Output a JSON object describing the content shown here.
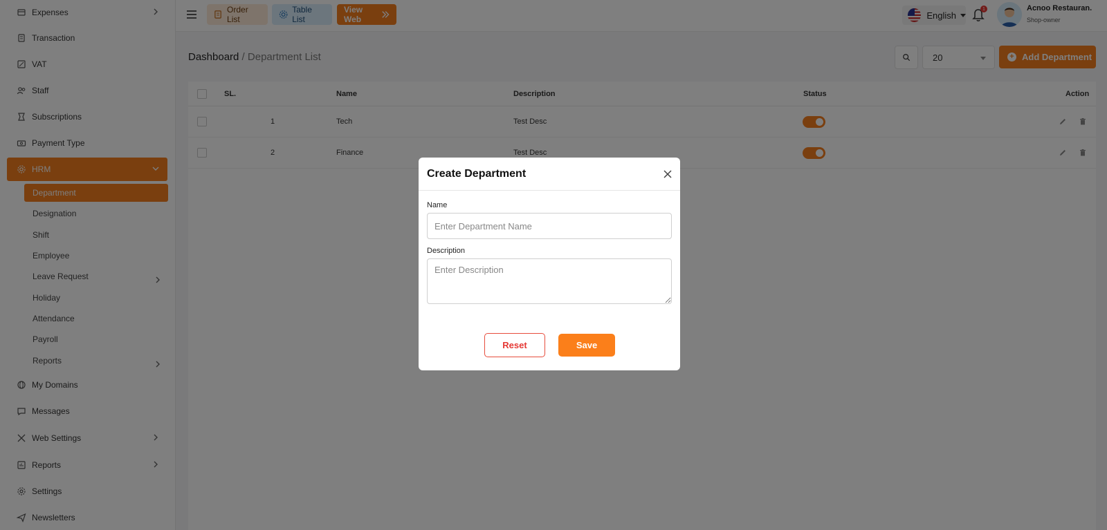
{
  "colors": {
    "accent": "#f47e1f",
    "danger": "#e53935"
  },
  "sidebar": {
    "items": [
      {
        "label": "Expenses",
        "icon": "expenses-icon",
        "has_chevron": true
      },
      {
        "label": "Transaction",
        "icon": "transaction-icon",
        "has_chevron": false
      },
      {
        "label": "VAT",
        "icon": "vat-icon",
        "has_chevron": false
      },
      {
        "label": "Staff",
        "icon": "staff-icon",
        "has_chevron": false
      },
      {
        "label": "Subscriptions",
        "icon": "subscriptions-icon",
        "has_chevron": false
      },
      {
        "label": "Payment Type",
        "icon": "payment-type-icon",
        "has_chevron": false
      },
      {
        "label": "HRM",
        "icon": "hrm-gear-icon",
        "has_chevron": true,
        "active": true
      }
    ],
    "hrm_sub": [
      {
        "label": "Department",
        "active": true
      },
      {
        "label": "Designation"
      },
      {
        "label": "Shift"
      },
      {
        "label": "Employee"
      },
      {
        "label": "Leave Request",
        "has_chevron": true
      },
      {
        "label": "Holiday"
      },
      {
        "label": "Attendance"
      },
      {
        "label": "Payroll"
      },
      {
        "label": "Reports",
        "has_chevron": true
      }
    ],
    "items_after": [
      {
        "label": "My Domains",
        "icon": "domains-icon"
      },
      {
        "label": "Messages",
        "icon": "messages-icon"
      },
      {
        "label": "Web Settings",
        "icon": "web-settings-icon",
        "has_chevron": true
      },
      {
        "label": "Reports",
        "icon": "reports-icon",
        "has_chevron": true
      },
      {
        "label": "Settings",
        "icon": "settings-icon"
      },
      {
        "label": "Newsletters",
        "icon": "newsletters-icon"
      }
    ]
  },
  "topbar": {
    "order_list": "Order List",
    "table_list": "Table List",
    "view_web": "View Web",
    "language": "English",
    "notification_count": "1",
    "user_name": "Acnoo Restauran.",
    "user_role": "Shop-owner"
  },
  "main": {
    "breadcrumb_root": "Dashboard",
    "breadcrumb_sep": " / ",
    "breadcrumb_current": "Department List",
    "per_page": "20",
    "add_button": "Add Department",
    "table": {
      "headers": {
        "sl": "SL.",
        "name": "Name",
        "description": "Description",
        "status": "Status",
        "action": "Action"
      },
      "rows": [
        {
          "sl": "1",
          "name": "Tech",
          "description": "Test Desc",
          "status_on": true
        },
        {
          "sl": "2",
          "name": "Finance",
          "description": "Test Desc",
          "status_on": true
        }
      ]
    }
  },
  "modal": {
    "title": "Create Department",
    "name_label": "Name",
    "name_placeholder": "Enter Department Name",
    "description_label": "Description",
    "description_placeholder": "Enter Description",
    "reset": "Reset",
    "save": "Save"
  }
}
